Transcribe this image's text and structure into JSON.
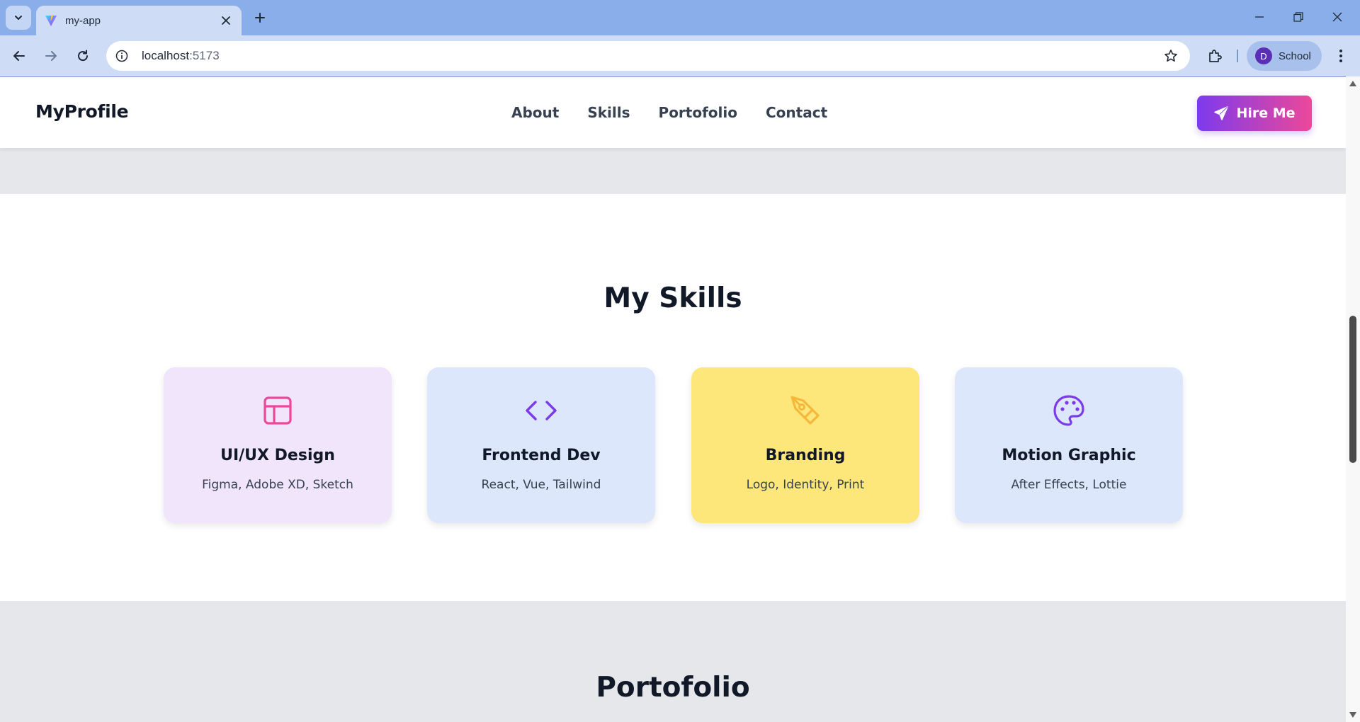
{
  "browser": {
    "tab_title": "my-app",
    "url_host": "localhost",
    "url_port": ":5173",
    "profile_initial": "D",
    "profile_name": "School"
  },
  "site": {
    "brand": "MyProfile",
    "nav": [
      "About",
      "Skills",
      "Portofolio",
      "Contact"
    ],
    "cta_label": "Hire Me",
    "cta_icon": "send-icon",
    "colors": {
      "cta_gradient_start": "#7c3aed",
      "cta_gradient_end": "#ec4899",
      "band_gray": "#e5e7eb"
    }
  },
  "skills": {
    "title": "My Skills",
    "cards": [
      {
        "name": "UI/UX Design",
        "tools": "Figma, Adobe XD, Sketch",
        "icon": "layout-icon",
        "bg": "#f0e5fb",
        "icon_color": "#ec4899"
      },
      {
        "name": "Frontend Dev",
        "tools": "React, Vue, Tailwind",
        "icon": "code-icon",
        "bg": "#dde7fb",
        "icon_color": "#7c3aed"
      },
      {
        "name": "Branding",
        "tools": "Logo, Identity, Print",
        "icon": "pen-tool-icon",
        "bg": "#fde77b",
        "icon_color": "#f5b83a"
      },
      {
        "name": "Motion Graphic",
        "tools": "After Effects, Lottie",
        "icon": "palette-icon",
        "bg": "#dde7fb",
        "icon_color": "#7c3aed"
      }
    ]
  },
  "portfolio": {
    "title": "Portofolio"
  }
}
